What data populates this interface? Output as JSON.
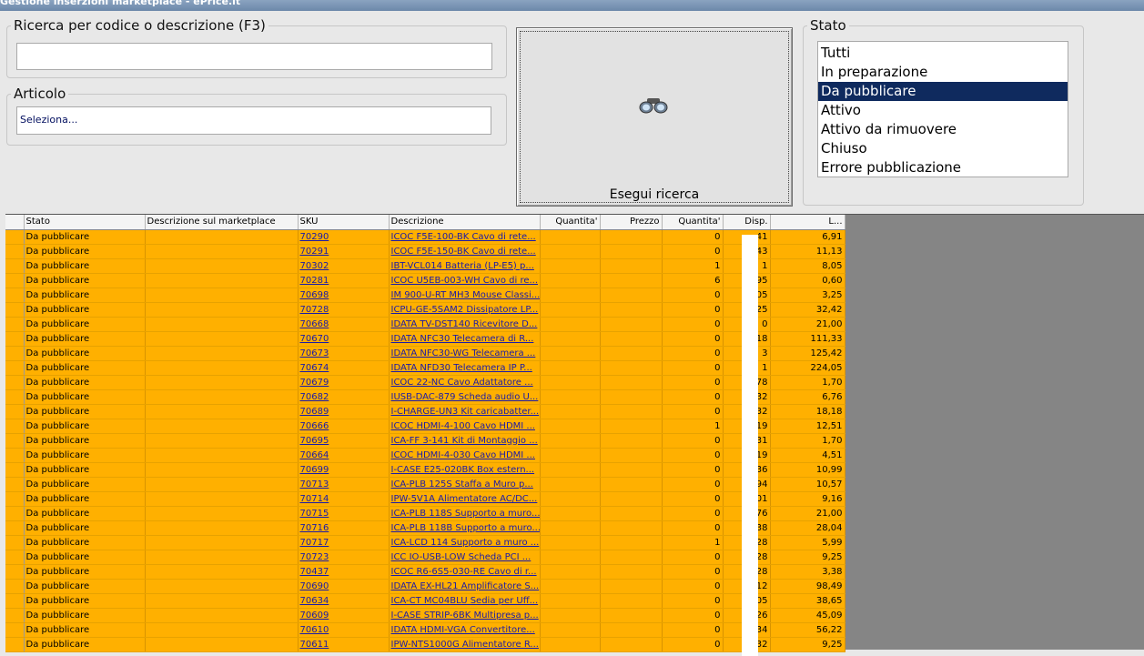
{
  "window": {
    "title": "Gestione inserzioni marketplace - ePrice.it"
  },
  "search_code": {
    "legend": "Ricerca per codice o descrizione (F3)",
    "value": ""
  },
  "article": {
    "legend": "Articolo",
    "value": "Seleziona..."
  },
  "search_button": {
    "label": "Esegui ricerca",
    "icon": "binoculars-icon"
  },
  "stato": {
    "legend": "Stato",
    "options": [
      "Tutti",
      "In preparazione",
      "Da pubblicare",
      "Attivo",
      "Attivo da rimuovere",
      "Chiuso",
      "Errore pubblicazione"
    ],
    "selected": "Da pubblicare"
  },
  "grid": {
    "columns": [
      "Stato",
      "Descrizione sul marketplace",
      "SKU",
      "Descrizione",
      "Quantita'",
      "Prezzo",
      "Quantita'",
      "Disp.",
      "L..."
    ],
    "row_color": "#ffb000",
    "rows": [
      [
        "Da pubblicare",
        "",
        "70290",
        "ICOC F5E-100-BK Cavo di rete...",
        "",
        "",
        "0",
        "41",
        "6,91"
      ],
      [
        "Da pubblicare",
        "",
        "70291",
        "ICOC F5E-150-BK Cavo di rete...",
        "",
        "",
        "0",
        "43",
        "11,13"
      ],
      [
        "Da pubblicare",
        "",
        "70302",
        "IBT-VCL014 Batteria (LP-E5) p...",
        "",
        "",
        "1",
        "1",
        "8,05"
      ],
      [
        "Da pubblicare",
        "",
        "70281",
        "ICOC U5EB-003-WH Cavo di re...",
        "",
        "",
        "6",
        "95",
        "0,60"
      ],
      [
        "Da pubblicare",
        "",
        "70698",
        "IM 900-U-RT MH3 Mouse Classi...",
        "",
        "",
        "0",
        "05",
        "3,25"
      ],
      [
        "Da pubblicare",
        "",
        "70728",
        "ICPU-GE-5SAM2 Dissipatore LP...",
        "",
        "",
        "0",
        "25",
        "32,42"
      ],
      [
        "Da pubblicare",
        "",
        "70668",
        "IDATA TV-DST140 Ricevitore D...",
        "",
        "",
        "0",
        "0",
        "21,00"
      ],
      [
        "Da pubblicare",
        "",
        "70670",
        "IDATA NFC30 Telecamera di R...",
        "",
        "",
        "0",
        "18",
        "111,33"
      ],
      [
        "Da pubblicare",
        "",
        "70673",
        "IDATA NFC30-WG Telecamera ...",
        "",
        "",
        "0",
        "3",
        "125,42"
      ],
      [
        "Da pubblicare",
        "",
        "70674",
        "IDATA NFD30 Telecamera IP P...",
        "",
        "",
        "0",
        "1",
        "224,05"
      ],
      [
        "Da pubblicare",
        "",
        "70679",
        "ICOC 22-NC Cavo Adattatore ...",
        "",
        "",
        "0",
        "78",
        "1,70"
      ],
      [
        "Da pubblicare",
        "",
        "70682",
        "IUSB-DAC-879 Scheda audio U...",
        "",
        "",
        "0",
        "32",
        "6,76"
      ],
      [
        "Da pubblicare",
        "",
        "70689",
        "I-CHARGE-UN3 Kit caricabatter...",
        "",
        "",
        "0",
        "32",
        "18,18"
      ],
      [
        "Da pubblicare",
        "",
        "70666",
        "ICOC HDMI-4-100 Cavo HDMI ...",
        "",
        "",
        "1",
        "19",
        "12,51"
      ],
      [
        "Da pubblicare",
        "",
        "70695",
        "ICA-FF 3-141 Kit di Montaggio ...",
        "",
        "",
        "0",
        "31",
        "1,70"
      ],
      [
        "Da pubblicare",
        "",
        "70664",
        "ICOC HDMI-4-030 Cavo HDMI ...",
        "",
        "",
        "0",
        "19",
        "4,51"
      ],
      [
        "Da pubblicare",
        "",
        "70699",
        "I-CASE E25-020BK Box estern...",
        "",
        "",
        "0",
        "36",
        "10,99"
      ],
      [
        "Da pubblicare",
        "",
        "70713",
        "ICA-PLB 125S Staffa a Muro p...",
        "",
        "",
        "0",
        "94",
        "10,57"
      ],
      [
        "Da pubblicare",
        "",
        "70714",
        "IPW-5V1A Alimentatore AC/DC...",
        "",
        "",
        "0",
        "01",
        "9,16"
      ],
      [
        "Da pubblicare",
        "",
        "70715",
        "ICA-PLB 118S Supporto a muro...",
        "",
        "",
        "0",
        "76",
        "21,00"
      ],
      [
        "Da pubblicare",
        "",
        "70716",
        "ICA-PLB 118B Supporto a muro...",
        "",
        "",
        "0",
        "38",
        "28,04"
      ],
      [
        "Da pubblicare",
        "",
        "70717",
        "ICA-LCD 114 Supporto a muro ...",
        "",
        "",
        "1",
        "28",
        "5,99"
      ],
      [
        "Da pubblicare",
        "",
        "70723",
        "ICC IO-USB-LOW Scheda PCI ...",
        "",
        "",
        "0",
        "28",
        "9,25"
      ],
      [
        "Da pubblicare",
        "",
        "70437",
        "ICOC R6-6S5-030-RE Cavo di r...",
        "",
        "",
        "0",
        "28",
        "3,38"
      ],
      [
        "Da pubblicare",
        "",
        "70690",
        "IDATA EX-HL21 Amplificatore S...",
        "",
        "",
        "0",
        "12",
        "98,49"
      ],
      [
        "Da pubblicare",
        "",
        "70634",
        "ICA-CT MC04BLU Sedia per Uff...",
        "",
        "",
        "0",
        "05",
        "38,65"
      ],
      [
        "Da pubblicare",
        "",
        "70609",
        "I-CASE STRIP-6BK Multipresa p...",
        "",
        "",
        "0",
        "26",
        "45,09"
      ],
      [
        "Da pubblicare",
        "",
        "70610",
        "IDATA HDMI-VGA Convertitore...",
        "",
        "",
        "0",
        "34",
        "56,22"
      ],
      [
        "Da pubblicare",
        "",
        "70611",
        "IPW-NTS1000G Alimentatore R...",
        "",
        "",
        "0",
        "32",
        "9,25"
      ]
    ]
  }
}
